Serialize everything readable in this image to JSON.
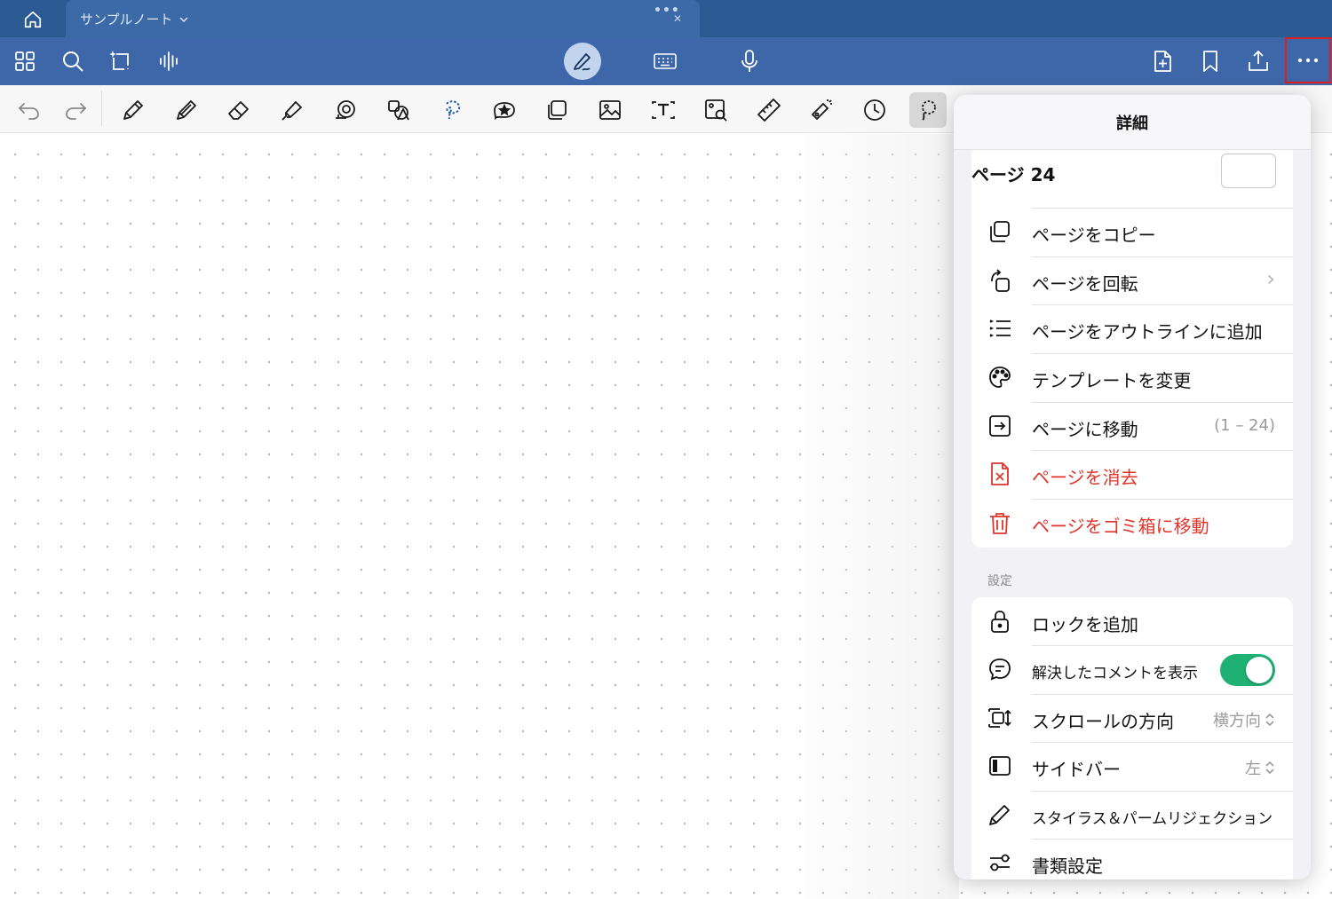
{
  "titlebar": {
    "tab_title": "サンプルノート",
    "tab_dots": "•••",
    "tab_close": "✕"
  },
  "icons": {
    "home": "home-icon",
    "grid": "grid-icon",
    "search": "search-icon",
    "ai_select": "ai-select-icon",
    "audio": "audio-waveform-icon",
    "pen_mode": "pen-mode-icon",
    "keyboard": "keyboard-icon",
    "mic": "microphone-icon",
    "add_page": "add-page-icon",
    "bookmark": "bookmark-icon",
    "share": "share-icon",
    "more": "more-icon"
  },
  "popover": {
    "title": "詳細",
    "page_label": "ページ 24",
    "page_items": [
      {
        "label": "ページをコピー"
      },
      {
        "label": "ページを回転",
        "right": "›"
      },
      {
        "label": "ページをアウトラインに追加"
      },
      {
        "label": "テンプレートを変更"
      },
      {
        "label": "ページに移動",
        "right": "(1 – 24)"
      },
      {
        "label": "ページを消去",
        "danger": true
      },
      {
        "label": "ページをゴミ箱に移動",
        "danger": true
      }
    ],
    "settings_header": "設定",
    "settings_items": [
      {
        "label": "ロックを追加"
      },
      {
        "label": "解決したコメントを表示",
        "toggle": true,
        "toggle_on": true
      },
      {
        "label": "スクロールの方向",
        "right": "横方向"
      },
      {
        "label": "サイドバー",
        "right": "左"
      },
      {
        "label": "スタイラス＆パームリジェクション"
      },
      {
        "label": "書類設定"
      }
    ]
  },
  "colors": {
    "titlebar": "#2c5a92",
    "toolbar": "#3d67a8",
    "danger": "#e0342a",
    "toggle_on": "#1fb174",
    "highlight_box": "#e11d1d"
  }
}
